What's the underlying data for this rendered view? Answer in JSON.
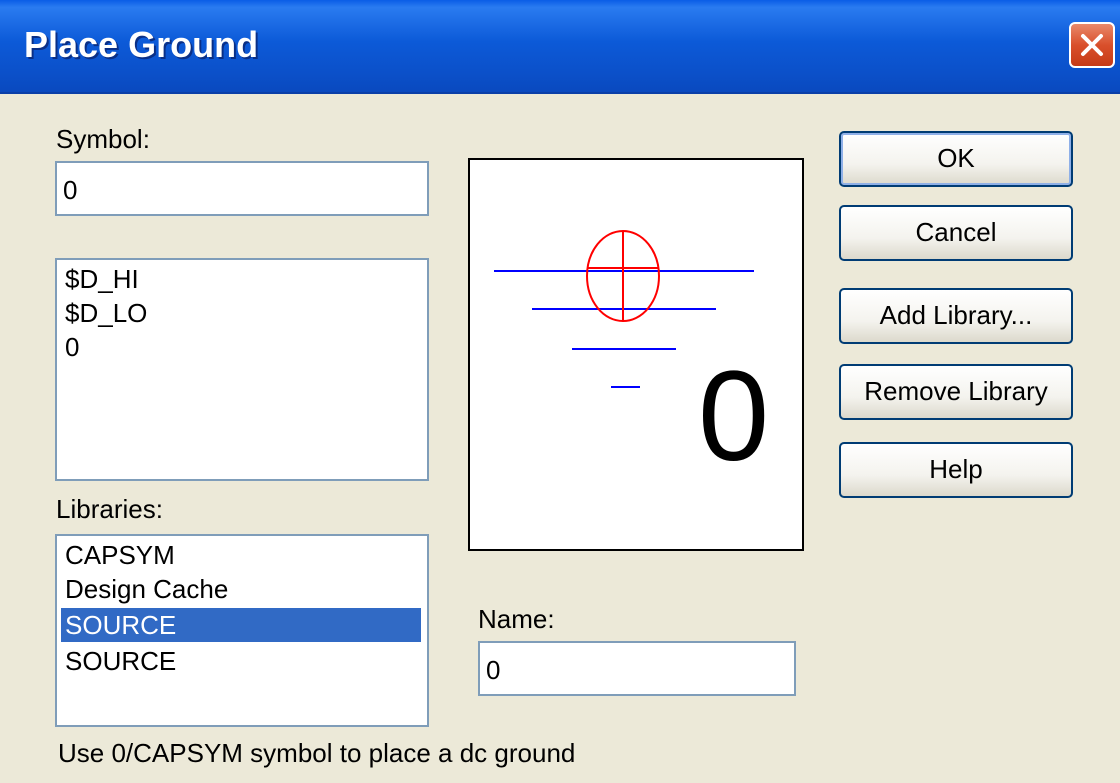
{
  "window": {
    "title": "Place Ground"
  },
  "symbol": {
    "label": "Symbol:",
    "value": "0",
    "items": [
      "$D_HI",
      "$D_LO",
      "0"
    ]
  },
  "libraries": {
    "label": "Libraries:",
    "items": [
      "CAPSYM",
      "Design Cache",
      "SOURCE",
      "SOURCE"
    ],
    "selected_index": 2
  },
  "preview": {
    "symbol_text": "0"
  },
  "name": {
    "label": "Name:",
    "value": "0"
  },
  "buttons": {
    "ok": "OK",
    "cancel": "Cancel",
    "add_library": "Add Library...",
    "remove_library": "Remove Library",
    "help": "Help"
  },
  "status_text": "Use 0/CAPSYM symbol to place a dc ground",
  "icons": {
    "close": "close-icon"
  },
  "colors": {
    "title_bar": "#0c5ad8",
    "close_button": "#d9502c",
    "selection": "#316ac5",
    "ground_lines": "#0000ff",
    "origin_marker": "#ff0000"
  }
}
